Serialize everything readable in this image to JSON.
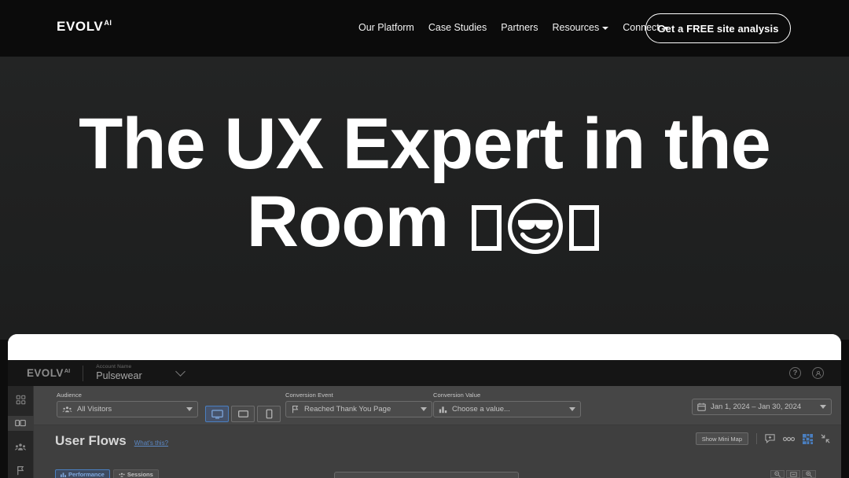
{
  "site_nav": {
    "brand": {
      "main": "EVOLV",
      "sup": "AI"
    },
    "links": [
      {
        "label": "Our Platform",
        "has_caret": false
      },
      {
        "label": "Case Studies",
        "has_caret": false
      },
      {
        "label": "Partners",
        "has_caret": false
      },
      {
        "label": "Resources",
        "has_caret": true
      },
      {
        "label": "Connect",
        "has_caret": true
      }
    ],
    "cta_label": "Get a FREE site analysis"
  },
  "hero": {
    "title_line1": "The UX Expert in the",
    "title_line2": "Room",
    "emoji_note": "tofu-box sunglasses-smiley tofu-box"
  },
  "app": {
    "header": {
      "logo_main": "EVOLV",
      "logo_sup": "AI",
      "account_label": "Account Name",
      "account_value": "Pulsewear",
      "help_icon": "question-mark-icon",
      "account_icon": "user-circle-icon"
    },
    "sidebar": [
      {
        "name": "dashboard",
        "icon": "grid-icon",
        "active": false
      },
      {
        "name": "user-flows",
        "icon": "flow-screen-icon",
        "active": true
      },
      {
        "name": "audience",
        "icon": "people-icon",
        "active": false
      },
      {
        "name": "goals",
        "icon": "flag-icon",
        "active": false
      }
    ],
    "filters": {
      "audience": {
        "label": "Audience",
        "value": "All Visitors",
        "icon": "people-icon"
      },
      "devices": [
        {
          "name": "desktop",
          "icon": "monitor-icon",
          "active": true
        },
        {
          "name": "tablet",
          "icon": "tablet-icon",
          "active": false
        },
        {
          "name": "mobile",
          "icon": "phone-icon",
          "active": false
        }
      ],
      "conversion_event": {
        "label": "Conversion Event",
        "value": "Reached Thank You Page",
        "icon": "flag-icon"
      },
      "conversion_value": {
        "label": "Conversion Value",
        "value": "Choose a value...",
        "icon": "bar-chart-icon"
      },
      "date_range": {
        "value": "Jan 1, 2024 – Jan 30, 2024",
        "icon": "calendar-icon"
      }
    },
    "flows": {
      "title": "User Flows",
      "whats_this": "What's this?",
      "mini_map_button": "Show Mini Map",
      "tools": [
        {
          "name": "add-comment",
          "icon": "comment-plus-icon"
        },
        {
          "name": "more-options",
          "icon": "dots-icon"
        },
        {
          "name": "heatmap-grid",
          "icon": "grid-blue-icon"
        },
        {
          "name": "collapse",
          "icon": "collapse-arrows-icon"
        }
      ],
      "tabs": [
        {
          "label": "Performance",
          "icon": "chart-icon",
          "active": true
        },
        {
          "label": "Sessions",
          "icon": "people-icon",
          "active": false
        }
      ],
      "zoom_controls": [
        {
          "name": "zoom-out",
          "icon": "magnifier-minus-icon"
        },
        {
          "name": "fit-to-screen",
          "icon": "fit-icon"
        },
        {
          "name": "zoom-in",
          "icon": "magnifier-plus-icon"
        }
      ]
    }
  },
  "colors": {
    "page_bg": "#0b0b0b",
    "hero_bg": "#202121",
    "accent_blue": "#5b88c4",
    "app_panel": "#ffffff",
    "app_header": "#151515"
  }
}
